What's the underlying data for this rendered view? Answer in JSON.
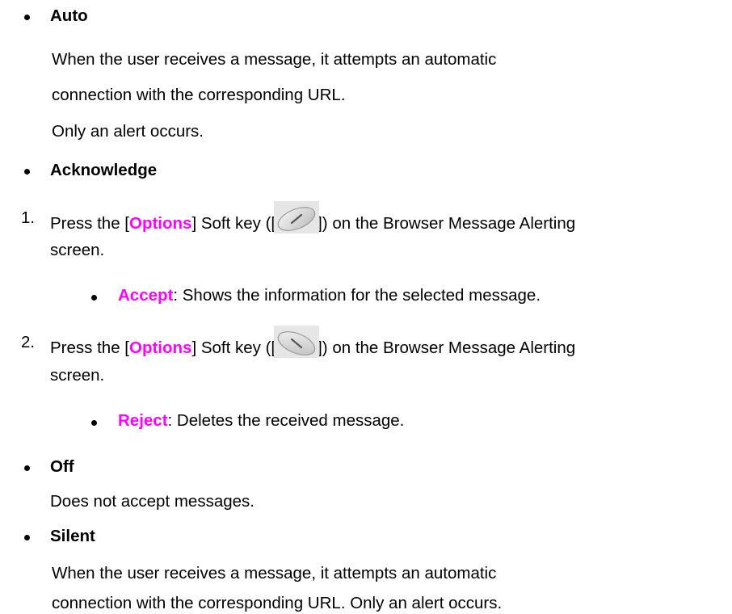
{
  "colors": {
    "text": "#000000",
    "highlight": "#ff00ff"
  },
  "items": {
    "auto": {
      "title": "Auto",
      "lines": [
        "When the user receives a message, it attempts an automatic",
        "connection with the corresponding URL.",
        "Only an alert occurs."
      ]
    },
    "acknowledge": {
      "title": "Acknowledge",
      "steps": [
        {
          "number": "1.",
          "prefix": "Press the [",
          "key": "Options",
          "middle": "] Soft key ([",
          "suffix": "]) on the Browser Message Alerting",
          "cont": "screen.",
          "softkey_icon": "left-soft-key-icon",
          "sub_label": "Accept",
          "sub_text": ": Shows the information for the selected message."
        },
        {
          "number": "2.",
          "prefix": "Press the [",
          "key": "Options",
          "middle": "] Soft key ([",
          "suffix": "]) on the Browser Message Alerting",
          "cont": "screen.",
          "softkey_icon": "right-soft-key-icon",
          "sub_label": "Reject",
          "sub_text": ": Deletes the received message."
        }
      ]
    },
    "off": {
      "title": "Off",
      "lines": [
        "Does not accept messages."
      ]
    },
    "silent": {
      "title": "Silent",
      "lines": [
        "When the user receives a message, it attempts an automatic",
        "connection with the corresponding URL. Only an alert occurs."
      ]
    }
  }
}
